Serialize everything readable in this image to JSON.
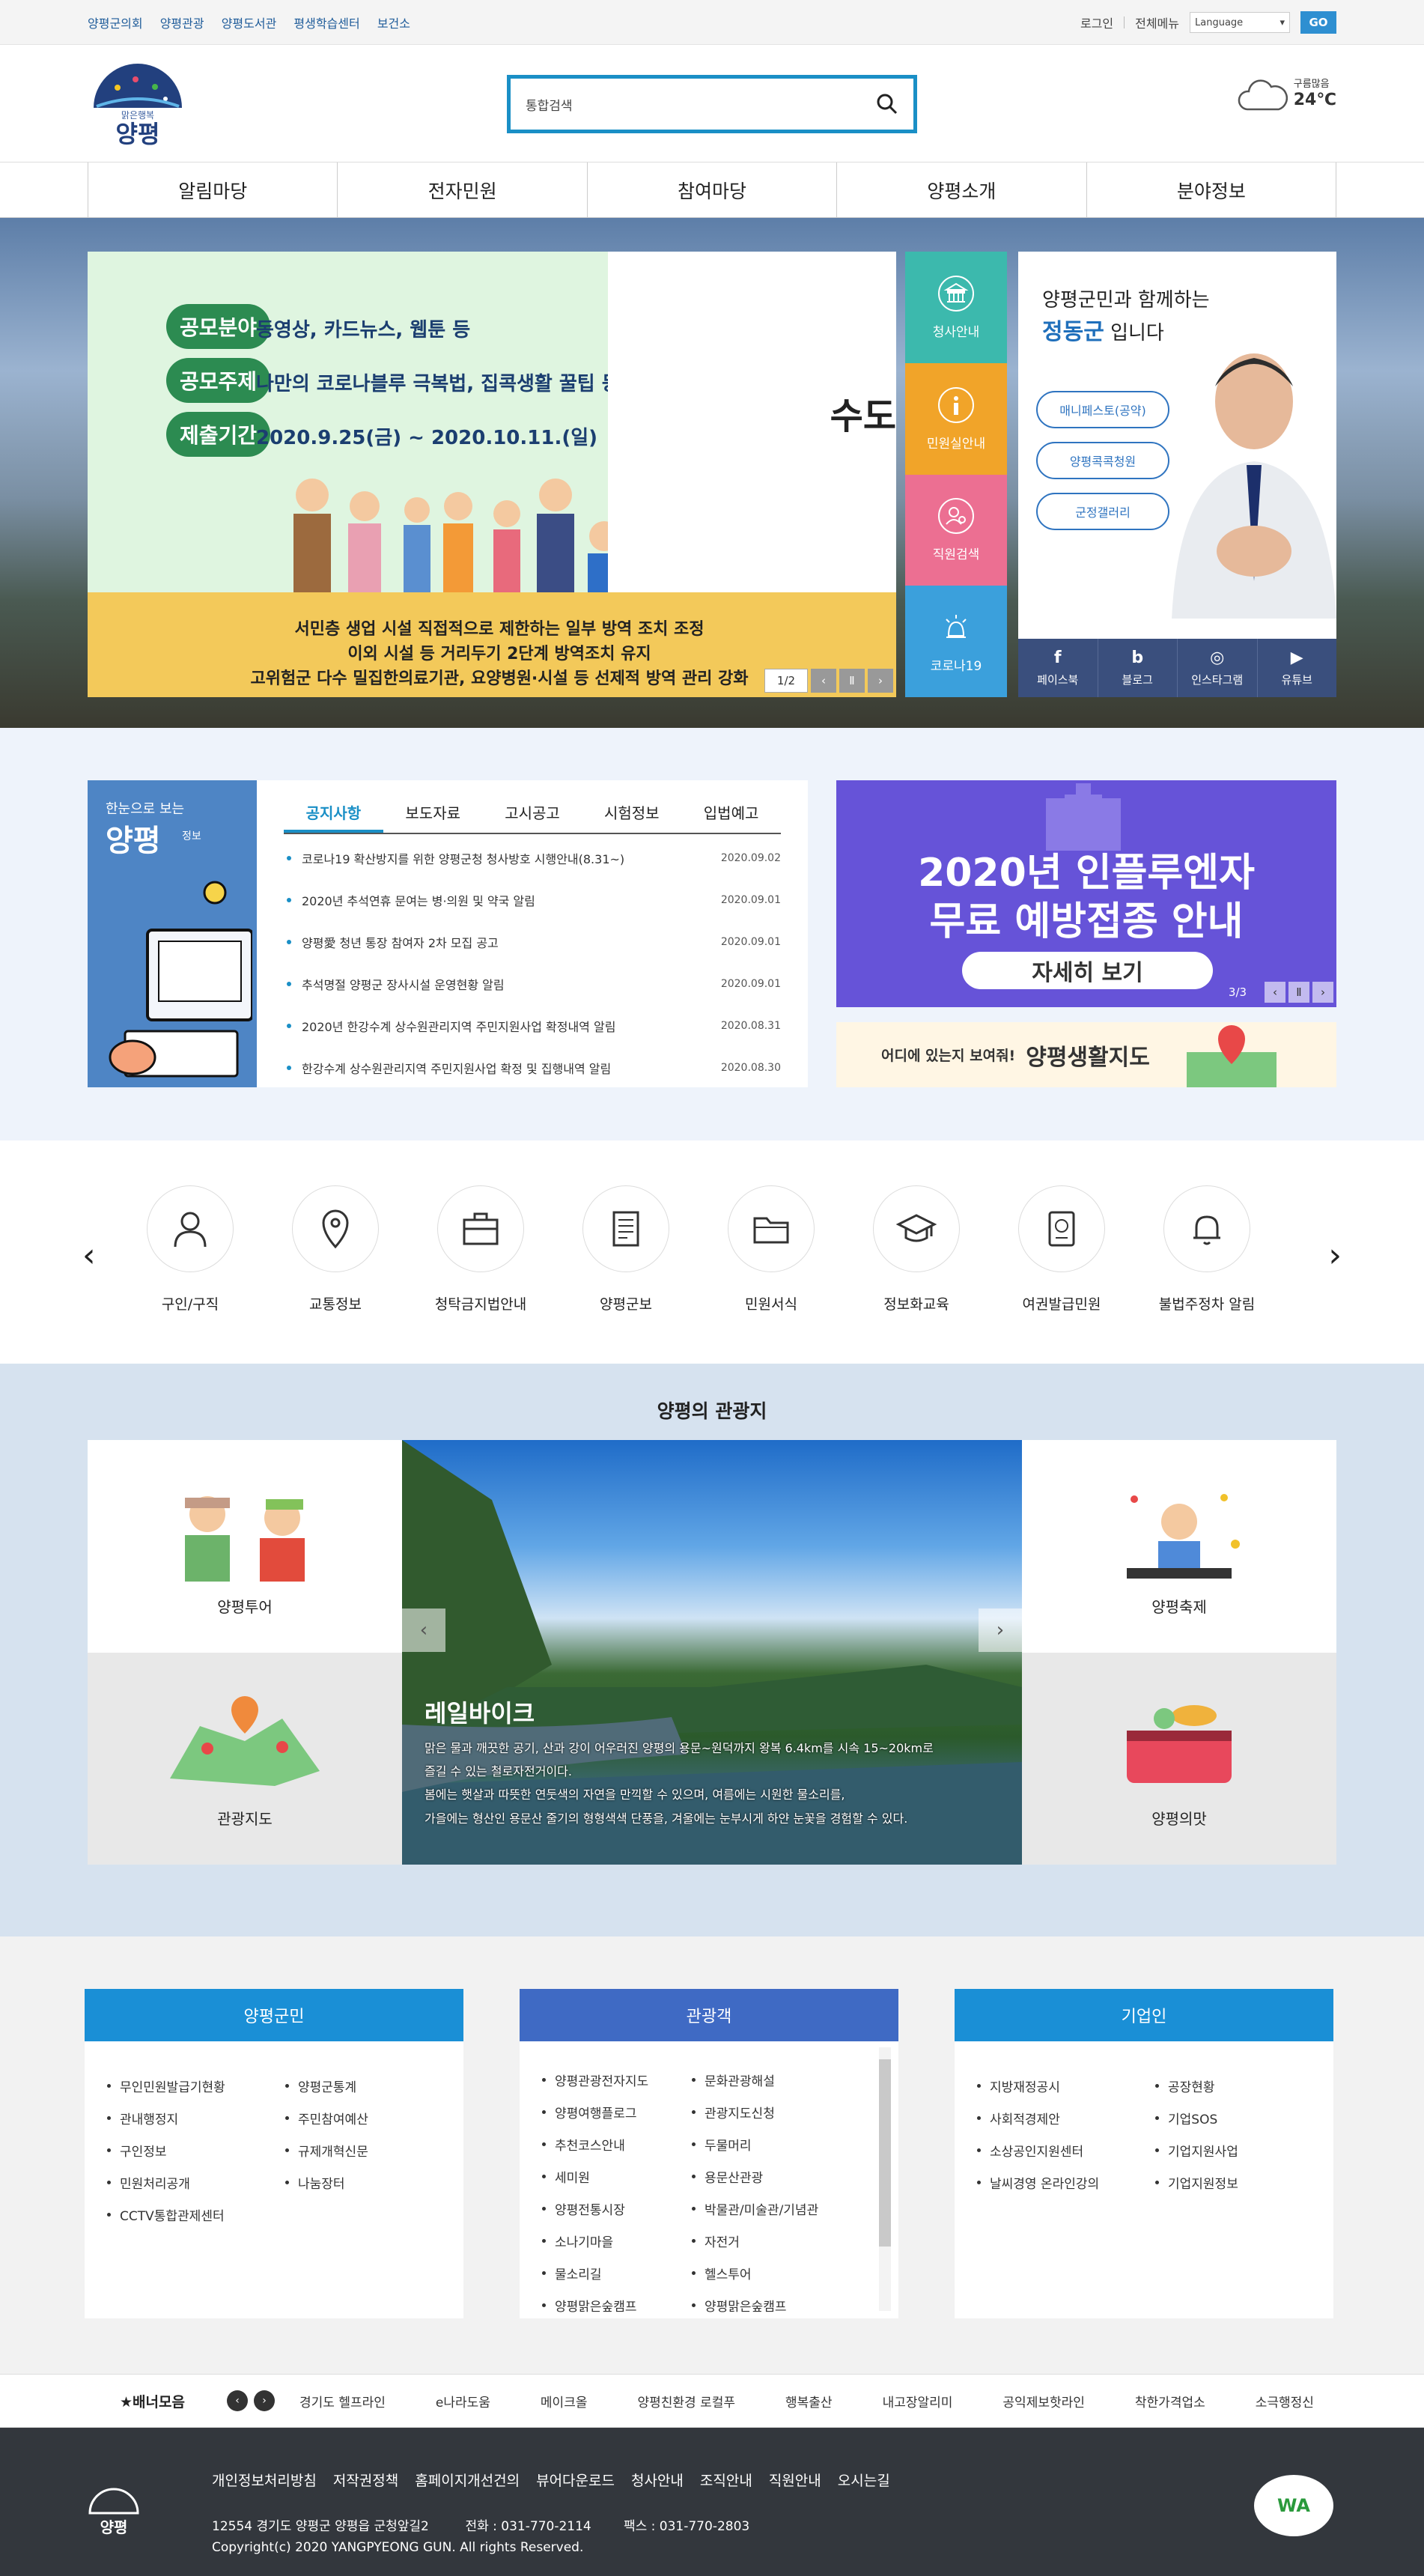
{
  "topbar": {
    "links": [
      "양평군의회",
      "양평관광",
      "양평도서관",
      "평생학습센터",
      "보건소"
    ],
    "login": "로그인",
    "all_menu": "전체메뉴",
    "language": "Language",
    "go": "GO"
  },
  "header": {
    "logo_small": "맑은행복",
    "logo_text": "양평",
    "search_placeholder": "통합검색",
    "weather_state": "구름많음",
    "weather_temp": "24℃"
  },
  "gnb": [
    "알림마당",
    "전자민원",
    "참여마당",
    "양평소개",
    "분야정보"
  ],
  "main_banner": {
    "rows": [
      {
        "label": "공모분야",
        "text": "동영상, 카드뉴스, 웹툰 등"
      },
      {
        "label": "공모주제",
        "text": "나만의 코로나블루 극복법, 집콕생활 꿀팁 등"
      },
      {
        "label": "제출기간",
        "text": "2020.9.25(금) ~ 2020.10.11.(일)"
      }
    ],
    "right_text": "수도",
    "covid_lines": [
      "서민층 생업 시설 직접적으로 제한하는 일부 방역 조치 조정",
      "이외 시설 등 거리두기 2단계 방역조치 유지",
      "고위험군 다수 밀집한의료기관, 요양병원·시설 등 선제적 방역 관리 강화"
    ],
    "page": "1/2"
  },
  "quick_menu": [
    {
      "label": "청사안내",
      "color": "#3cb9ad"
    },
    {
      "label": "민원실안내",
      "color": "#f1a429"
    },
    {
      "label": "직원검색",
      "color": "#ec6f92"
    },
    {
      "label": "코로나19",
      "color": "#3ba0dc"
    }
  ],
  "mayor": {
    "line1": "양평군민과 함께하는",
    "name": "정동군",
    "line2": " 입니다",
    "buttons": [
      "매니페스토(공약)",
      "양평콕콕청원",
      "군정갤러리"
    ],
    "sns": [
      {
        "icon": "f",
        "label": "페이스북"
      },
      {
        "icon": "b",
        "label": "블로그"
      },
      {
        "icon": "◎",
        "label": "인스타그램"
      },
      {
        "icon": "▶",
        "label": "유튜브"
      }
    ]
  },
  "news": {
    "side_caption": "한눈으로 보는",
    "side_title": "양평",
    "side_sub": "정보",
    "tabs": [
      "공지사항",
      "보도자료",
      "고시공고",
      "시험정보",
      "입법예고"
    ],
    "items": [
      {
        "title": "코로나19 확산방지를 위한 양평군청 청사방호 시행안내(8.31~)",
        "date": "2020.09.02"
      },
      {
        "title": "2020년 추석연휴 문여는 병·의원 및 약국 알림",
        "date": "2020.09.01"
      },
      {
        "title": "양평愛 청년 통장 참여자 2차 모집 공고",
        "date": "2020.09.01"
      },
      {
        "title": "추석명절 양평군 장사시설 운영현황 알림",
        "date": "2020.09.01"
      },
      {
        "title": "2020년 한강수계 상수원관리지역 주민지원사업 확정내역 알림",
        "date": "2020.08.31"
      },
      {
        "title": "한강수계 상수원관리지역 주민지원사업 확정 및 집행내역 알림",
        "date": "2020.08.30"
      }
    ]
  },
  "flu_banner": {
    "line1": "2020년 인플루엔자",
    "line2": "무료 예방접종 안내",
    "button": "자세히 보기",
    "page": "3/3"
  },
  "map_banner": {
    "small": "어디에 있는지 보여줘!",
    "title": "양평생활지도"
  },
  "icons": [
    {
      "label": "구인/구직",
      "icon": "person-icon"
    },
    {
      "label": "교통정보",
      "icon": "map-pin-icon"
    },
    {
      "label": "청탁금지법안내",
      "icon": "briefcase-icon"
    },
    {
      "label": "양평군보",
      "icon": "document-icon"
    },
    {
      "label": "민원서식",
      "icon": "folder-icon"
    },
    {
      "label": "정보화교육",
      "icon": "graduation-cap-icon"
    },
    {
      "label": "여권발급민원",
      "icon": "passport-icon"
    },
    {
      "label": "불법주정차 알림",
      "icon": "bell-icon"
    }
  ],
  "tour": {
    "title": "양평의 관광지",
    "cells": [
      "양평투어",
      "양평축제",
      "관광지도",
      "양평의맛"
    ],
    "photo_title": "레일바이크",
    "photo_desc": [
      "맑은 물과 깨끗한 공기, 산과 강이 어우러진 양평의 용문~원덕까지 왕복 6.4km를 시속 15~20km로",
      "즐길 수 있는 철로자전거이다.",
      "봄에는 햇살과 따뜻한 연둣색의 자연을 만끽할 수 있으며, 여름에는 시원한 물소리를,",
      "가을에는 형산인 용문산 줄기의 형형색색 단풍을, 겨울에는 눈부시게 하얀 눈꽃을 경험할 수 있다."
    ]
  },
  "portals": [
    {
      "title": "양평군민",
      "color": "#1a8fd6",
      "col1": [
        "무인민원발급기현황",
        "관내행정지",
        "구인정보",
        "민원처리공개",
        "CCTV통합관제센터"
      ],
      "col2": [
        "양평군통계",
        "주민참여예산",
        "규제개혁신문",
        "나눔장터"
      ]
    },
    {
      "title": "관광객",
      "color": "#3f6ac4",
      "col1": [
        "양평관광전자지도",
        "양평여행플로그",
        "추천코스안내",
        "세미원",
        "양평전통시장",
        "소나기마을",
        "물소리길",
        "양평맑은숲캠프"
      ],
      "col2": [
        "문화관광해설",
        "관광지도신청",
        "두물머리",
        "용문산관광",
        "박물관/미술관/기념관",
        "자전거",
        "헬스투어",
        "양평맑은숲캠프"
      ]
    },
    {
      "title": "기업인",
      "color": "#1a8fd6",
      "col1": [
        "지방재정공시",
        "사회적경제안",
        "소상공인지원센터",
        "날씨경영 온라인강의"
      ],
      "col2": [
        "공장현황",
        "기업SOS",
        "기업지원사업",
        "기업지원정보"
      ]
    }
  ],
  "banner_bar": {
    "label": "배너모음",
    "links": [
      "경기도 헬프라인",
      "e나라도움",
      "메이크올",
      "양평친환경 로컬푸",
      "행복출산",
      "내고장알리미",
      "공익제보핫라인",
      "착한가격업소",
      "소극행정신"
    ]
  },
  "footer": {
    "logo_text": "양평",
    "links": [
      "개인정보처리방침",
      "저작권정책",
      "홈페이지개선건의",
      "뷰어다운로드",
      "청사안내",
      "조직안내",
      "직원안내",
      "오시는길"
    ],
    "address": "12554 경기도 양평군 양평읍 군청앞길2",
    "tel": "전화 : 031-770-2114",
    "fax": "팩스 : 031-770-2803",
    "copyright": "Copyright(c) 2020 YANGPYEONG GUN. All rights Reserved.",
    "wa": "WA"
  }
}
